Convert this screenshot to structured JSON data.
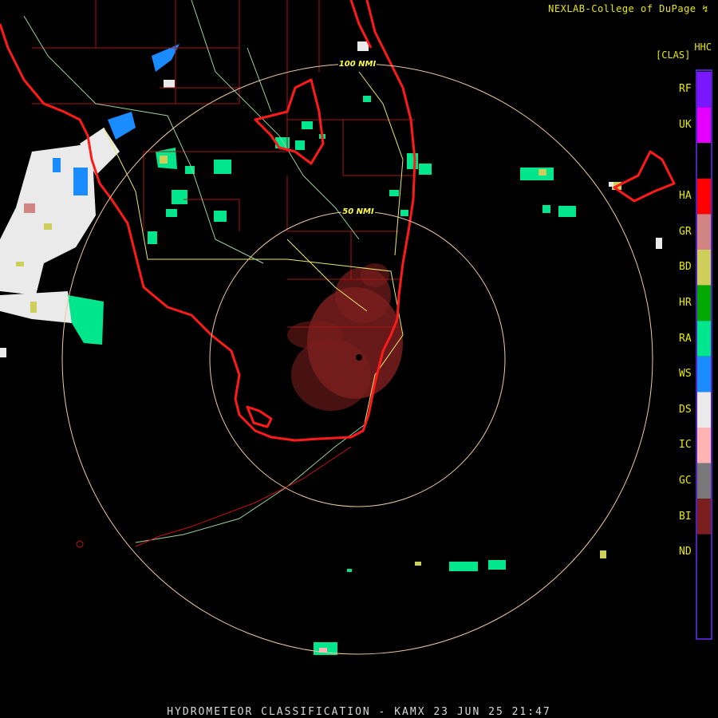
{
  "credit": "NEXLAB-College of DuPage",
  "credit_mark": "↯",
  "caption": "HYDROMETEOR CLASSIFICATION - KAMX 23 JUN 25 21:47",
  "legend": {
    "product_code": "HHC",
    "product_label": "[CLAS]",
    "border_color": "#6a2cff",
    "classes": [
      {
        "code": "RF",
        "color": "#7a17ff"
      },
      {
        "code": "UK",
        "color": "#e400ff"
      },
      {
        "code": "",
        "color": "#000000"
      },
      {
        "code": "HA",
        "color": "#ff0000"
      },
      {
        "code": "GR",
        "color": "#d08484"
      },
      {
        "code": "BD",
        "color": "#cece5a"
      },
      {
        "code": "HR",
        "color": "#00a800"
      },
      {
        "code": "RA",
        "color": "#00e68c"
      },
      {
        "code": "WS",
        "color": "#1a8cff"
      },
      {
        "code": "DS",
        "color": "#eaeaea"
      },
      {
        "code": "IC",
        "color": "#ffb4b4"
      },
      {
        "code": "GC",
        "color": "#787878"
      },
      {
        "code": "BI",
        "color": "#7a1e1e"
      },
      {
        "code": "ND",
        "color": "#000000"
      }
    ]
  },
  "range_rings": [
    {
      "label": "50 NMI"
    },
    {
      "label": "100 NMI"
    }
  ],
  "colors": {
    "coastline": "#ff1a1a",
    "county_lines": "#aa1414",
    "highways": "#e8e870",
    "rivers": "#9ad29a",
    "range_ring": "#f0c8a0"
  }
}
